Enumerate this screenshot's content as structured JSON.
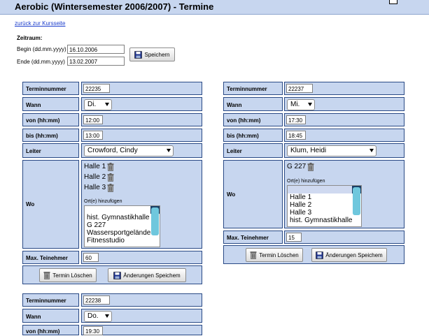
{
  "title": "Aerobic (Wintersemester 2006/2007) - Termine",
  "back_link": "zurück zur Kursseite",
  "zeitraum": {
    "heading": "Zeitraum:",
    "begin_label": "Begin (dd.mm.yyyy)",
    "begin_value": "16.10.2006",
    "end_label": "Ende (dd.mm.yyyy)",
    "end_value": "13.02.2007",
    "save_label": "Speichern"
  },
  "labels": {
    "terminnummer": "Terminnummer",
    "wann": "Wann",
    "von": "von (hh:mm)",
    "bis": "bis (hh:mm)",
    "leiter": "Leiter",
    "wo": "Wo",
    "max": "Max. Teinehmer",
    "add_rooms": "Ort(e) hinzufügen",
    "delete": "Termin Löschen",
    "save_changes": "Änderungen Speichem"
  },
  "termine": [
    {
      "nummer": "22235",
      "wann": "Di.",
      "von": "12:00",
      "bis": "13:00",
      "leiter": "Crowford, Cindy",
      "rooms": [
        "Halle 1",
        "Halle 2",
        "Halle 3"
      ],
      "options": [
        "",
        "hist. Gymnastikhalle",
        "G 227",
        "Wassersportgelände",
        "Fitnesstudio"
      ],
      "max": "60"
    },
    {
      "nummer": "22237",
      "wann": "Mi.",
      "von": "17:30",
      "bis": "18:45",
      "leiter": "Klum, Heidi",
      "rooms": [
        "G 227"
      ],
      "options": [
        "",
        "Halle 1",
        "Halle 2",
        "Halle 3",
        "hist. Gymnastikhalle"
      ],
      "max": "15"
    },
    {
      "nummer": "22238",
      "wann": "Do.",
      "von": "19:30"
    }
  ],
  "icons": {
    "save": "floppy-disk-icon",
    "trash": "trash-can-icon"
  }
}
